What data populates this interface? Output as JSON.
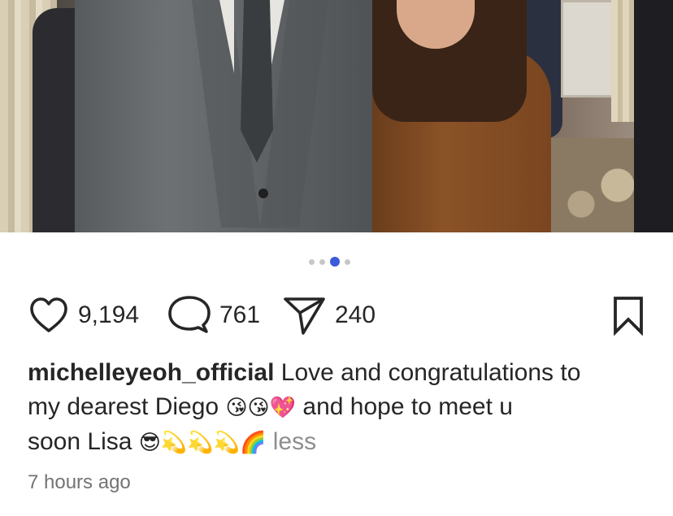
{
  "post": {
    "carousel": {
      "total": 4,
      "active_index": 2
    },
    "likes": "9,194",
    "comments": "761",
    "shares": "240",
    "caption": {
      "username": "michelleyeoh_official",
      "line1": "Love and congratulations to",
      "line2_a": "my dearest Diego",
      "emojis_a": "😘😘💖",
      "line2_b": "and hope to meet u",
      "line3_a": "soon Lisa",
      "emojis_b": "😎💫💫💫🌈",
      "less_label": "less"
    },
    "timestamp": "7 hours ago"
  },
  "icons": {
    "like": "heart-icon",
    "comment": "comment-bubble-icon",
    "share": "paper-plane-icon",
    "save": "bookmark-icon"
  },
  "colors": {
    "text": "#262626",
    "muted": "#8e8e8e",
    "carousel_active": "#3b5bdb",
    "carousel_inactive": "#c7c7c7"
  }
}
